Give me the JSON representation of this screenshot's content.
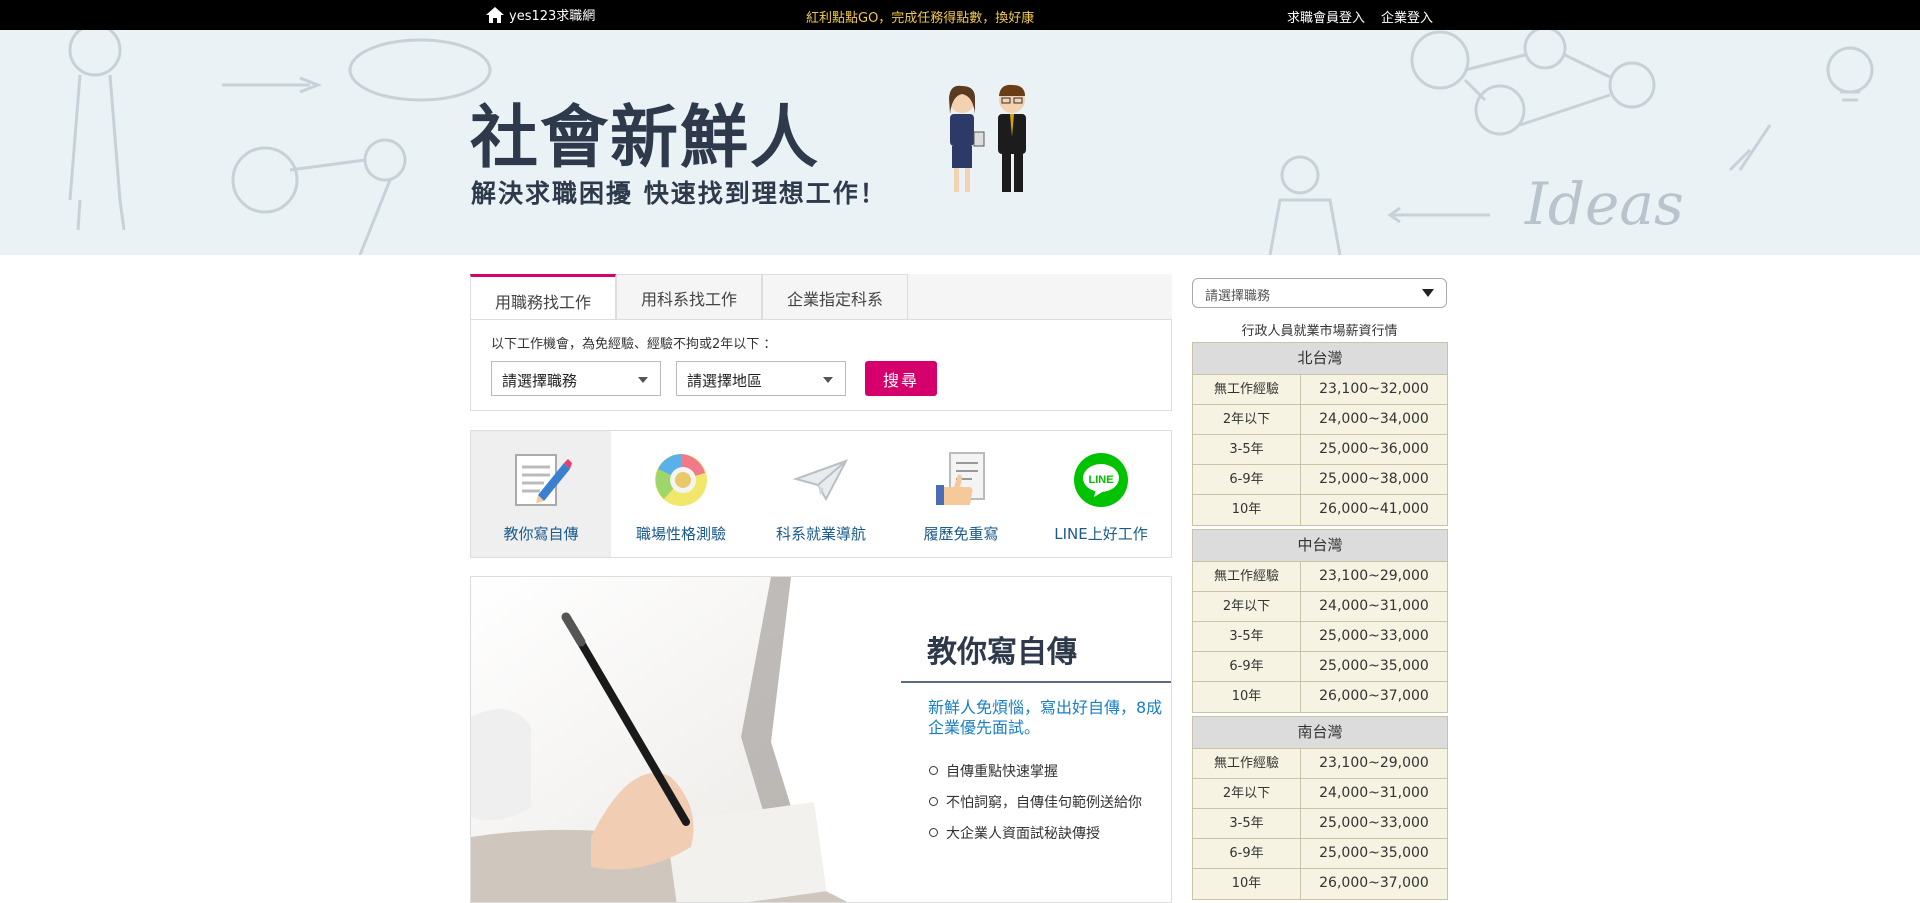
{
  "topbar": {
    "site_name": "yes123求職網",
    "promo": "紅利點點GO，完成任務得點數，換好康",
    "member_login": "求職會員登入",
    "company_login": "企業登入"
  },
  "banner": {
    "title": "社會新鮮人",
    "subtitle": "解決求職困擾  快速找到理想工作！",
    "decor_text": "Ideas"
  },
  "search": {
    "tabs": [
      {
        "label": "用職務找工作",
        "active": true
      },
      {
        "label": "用科系找工作",
        "active": false
      },
      {
        "label": "企業指定科系",
        "active": false
      }
    ],
    "hint": "以下工作機會，為免經驗、經驗不拘或2年以下 ：",
    "job_select": "請選擇職務",
    "area_select": "請選擇地區",
    "button": "搜尋"
  },
  "features": [
    {
      "label": "教你寫自傳",
      "icon": "pencil-document-icon",
      "active": true
    },
    {
      "label": "職場性格測驗",
      "icon": "color-wheel-icon",
      "active": false
    },
    {
      "label": "科系就業導航",
      "icon": "paper-plane-icon",
      "active": false
    },
    {
      "label": "履歷免重寫",
      "icon": "thumbs-up-document-icon",
      "active": false
    },
    {
      "label": "LINE上好工作",
      "icon": "line-icon",
      "active": false
    }
  ],
  "promo_card": {
    "title": "教你寫自傳",
    "description": "新鮮人免煩惱，寫出好自傳，8成企業優先面試。",
    "bullets": [
      "自傳重點快速掌握",
      "不怕詞窮，自傳佳句範例送給你",
      "大企業人資面試秘訣傳授"
    ]
  },
  "salary": {
    "select": "請選擇職務",
    "caption": "行政人員就業市場薪資行情",
    "regions": [
      {
        "name": "北台灣",
        "rows": [
          {
            "exp": "無工作經驗",
            "range": "23,100~32,000"
          },
          {
            "exp": "2年以下",
            "range": "24,000~34,000"
          },
          {
            "exp": "3-5年",
            "range": "25,000~36,000"
          },
          {
            "exp": "6-9年",
            "range": "25,000~38,000"
          },
          {
            "exp": "10年",
            "range": "26,000~41,000"
          }
        ]
      },
      {
        "name": "中台灣",
        "rows": [
          {
            "exp": "無工作經驗",
            "range": "23,100~29,000"
          },
          {
            "exp": "2年以下",
            "range": "24,000~31,000"
          },
          {
            "exp": "3-5年",
            "range": "25,000~33,000"
          },
          {
            "exp": "6-9年",
            "range": "25,000~35,000"
          },
          {
            "exp": "10年",
            "range": "26,000~37,000"
          }
        ]
      },
      {
        "name": "南台灣",
        "rows": [
          {
            "exp": "無工作經驗",
            "range": "23,100~29,000"
          },
          {
            "exp": "2年以下",
            "range": "24,000~31,000"
          },
          {
            "exp": "3-5年",
            "range": "25,000~33,000"
          },
          {
            "exp": "6-9年",
            "range": "25,000~35,000"
          },
          {
            "exp": "10年",
            "range": "26,000~37,000"
          }
        ]
      }
    ]
  },
  "colors": {
    "accent": "#d6006d",
    "link": "#1a5a8c",
    "line_green": "#00c300"
  }
}
